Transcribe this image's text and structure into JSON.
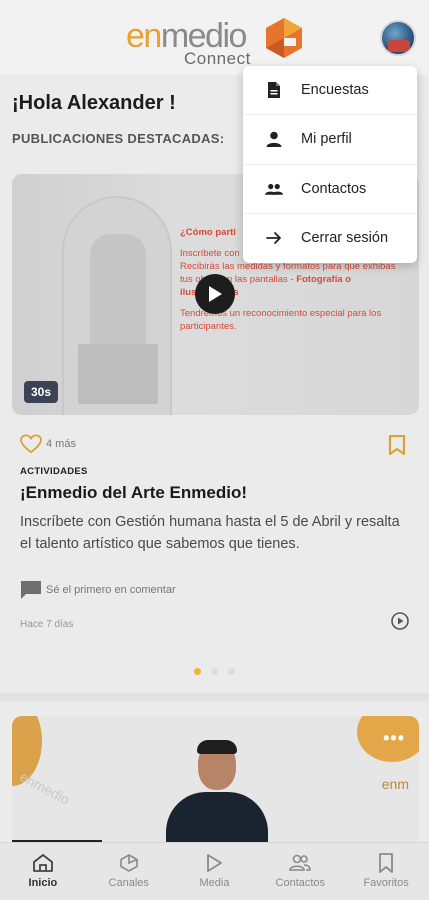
{
  "header": {
    "logo_prefix": "en",
    "logo_rest": "medio",
    "logo_sub": "Connect"
  },
  "greeting": "¡Hola Alexander !",
  "section_title": "PUBLICACIONES DESTACADAS:",
  "menu": {
    "items": [
      {
        "label": "Encuestas",
        "icon": "document-icon"
      },
      {
        "label": "Mi perfil",
        "icon": "person-icon"
      },
      {
        "label": "Contactos",
        "icon": "people-icon"
      },
      {
        "label": "Cerrar sesión",
        "icon": "arrow-right-icon"
      }
    ]
  },
  "post": {
    "media": {
      "promo_line1": "¿Cómo parti",
      "promo_line2": "Inscríbete con",
      "promo_line3": "Recibirás las medidas y formatos para que",
      "promo_line4": "exhibas tus obras en las pantallas -",
      "promo_highlight": "Fotografía o ilustraciones",
      "promo_line5": "Tendremos un reconocimiento especial para los participantes.",
      "duration": "30s"
    },
    "likes": "4 más",
    "category": "ACTIVIDADES",
    "title": "¡Enmedio del Arte Enmedio!",
    "body": "Inscríbete con Gestión humana hasta el 5 de Abril y resalta el talento artístico que sabemos que tienes.",
    "comment_prompt": "Sé el primero en comentar",
    "time_ago": "Hace 7 días"
  },
  "carousel": {
    "active_index": 0,
    "count": 3
  },
  "card2": {
    "more": "•••",
    "logo_left": "enmedio",
    "logo_right": "enm"
  },
  "nav": {
    "items": [
      {
        "label": "Inicio",
        "icon": "home-icon",
        "active": true
      },
      {
        "label": "Canales",
        "icon": "channels-icon",
        "active": false
      },
      {
        "label": "Media",
        "icon": "play-icon",
        "active": false
      },
      {
        "label": "Contactos",
        "icon": "contacts-icon",
        "active": false
      },
      {
        "label": "Favoritos",
        "icon": "bookmark-icon",
        "active": false
      }
    ]
  },
  "colors": {
    "accent": "#f0b23a",
    "brand_orange": "#e8732e",
    "promo_red": "#d44a3a"
  }
}
